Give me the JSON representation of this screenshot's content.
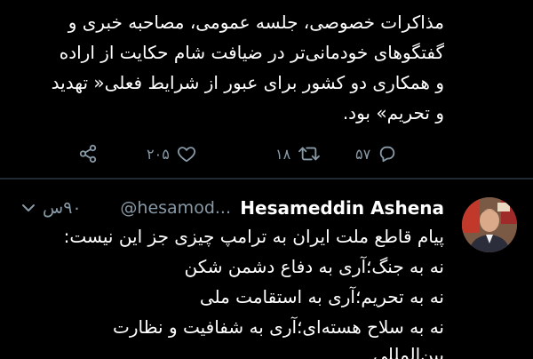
{
  "top_tweet": {
    "lines": [
      "",
      "مذاکرات خصوصی، جلسه عمومی، مصاحبه خبری و",
      "گفتگوهای خودمانی‌تر در ضیافت شام حکایت از اراده",
      "و همکاری دو کشور برای عبور از شرایط فعلی« تهدید",
      "و تحریم» بود."
    ],
    "actions": {
      "reply_count": "۵۷",
      "retweet_count": "۱۸",
      "like_count": "۲۰۵"
    }
  },
  "reply_tweet": {
    "author_name": "Hesameddin Ashena",
    "author_handle": "@hesamod...",
    "time_ago": "۹۰س",
    "lines": [
      "پیام قاطع ملت ایران به ترامپ چیزی جز این نیست:",
      "نه به جنگ؛آری به دفاع دشمن شکن",
      "نه به تحریم؛آری به استقامت ملی",
      "نه به سلاح هسته‌ای؛آری به شفافیت و نظارت",
      "بین‌المللی"
    ]
  },
  "icons": {
    "reply": "reply-icon",
    "retweet": "retweet-icon",
    "like": "heart-icon",
    "share": "share-icon",
    "menu": "chevron-down-icon"
  },
  "colors": {
    "background": "#000000",
    "text": "#ffffff",
    "muted": "#8899a6",
    "divider": "#1f2a33"
  }
}
